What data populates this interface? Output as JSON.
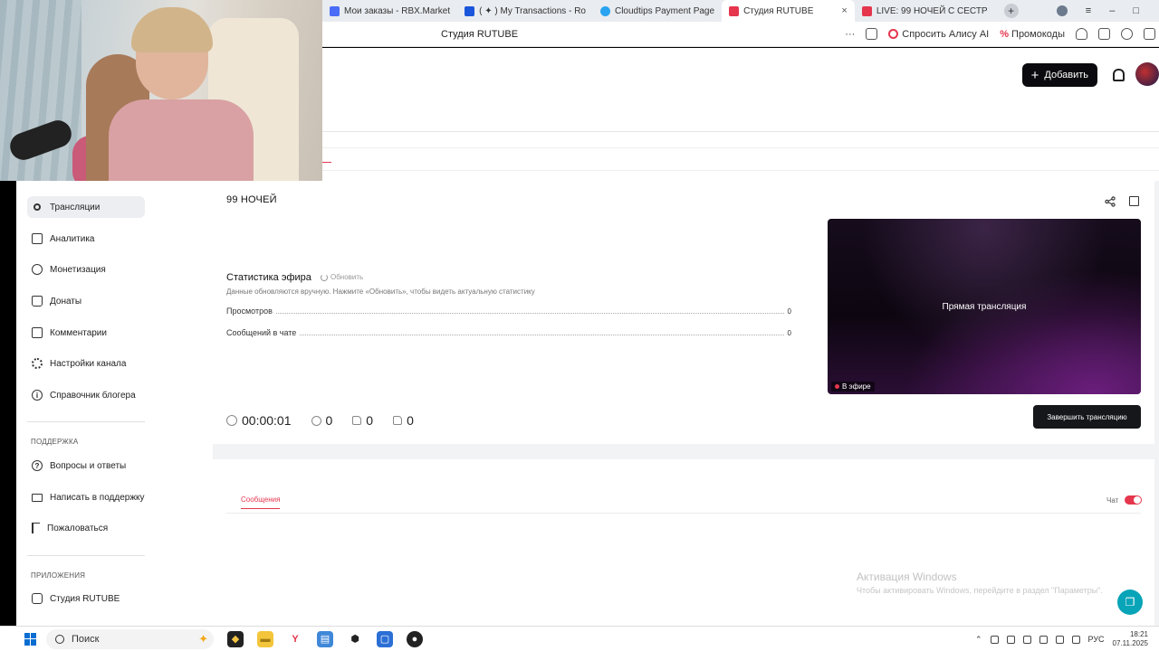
{
  "browser": {
    "tabs": [
      {
        "label": "Мои заказы - RBX.Market",
        "icon_color": "#4a6cf7",
        "active": false
      },
      {
        "label": "( ✦ ) My Transactions - Ro",
        "icon_color": "#1a56db",
        "active": false
      },
      {
        "label": "Cloudtips Payment Page",
        "icon_color": "#2aa3f0",
        "active": false
      },
      {
        "label": "Студия RUTUBE",
        "icon_color": "#e5364e",
        "active": true
      },
      {
        "label": "LIVE: 99 НОЧЕЙ С СЕСТР",
        "icon_color": "#e5364e",
        "active": false
      }
    ],
    "close_glyph": "×",
    "new_tab_glyph": "+",
    "window_controls": {
      "menu": "≡",
      "minimize": "–",
      "maximize": "□",
      "close": "×"
    },
    "address": "Студия RUTUBE",
    "more": "···",
    "alice_label": "Спросить Алису AI",
    "promo_label": "Промокоды",
    "promo_icon": "%"
  },
  "header": {
    "add_label": "Добавить",
    "add_icon": "+"
  },
  "sidebar": {
    "items": [
      {
        "label": "Трансляции",
        "icon": "broadcast-icon"
      },
      {
        "label": "Аналитика",
        "icon": "chart-icon"
      },
      {
        "label": "Монетизация",
        "icon": "coin-icon"
      },
      {
        "label": "Донаты",
        "icon": "bag-icon"
      },
      {
        "label": "Комментарии",
        "icon": "comment-icon"
      },
      {
        "label": "Настройки канала",
        "icon": "gear-icon"
      },
      {
        "label": "Справочник блогера",
        "icon": "info-icon"
      }
    ],
    "support_title": "ПОДДЕРЖКА",
    "support": [
      {
        "label": "Вопросы и ответы",
        "icon": "question-icon"
      },
      {
        "label": "Написать в поддержку",
        "icon": "mail-icon"
      },
      {
        "label": "Пожаловаться",
        "icon": "flag-icon"
      }
    ],
    "apps_title": "ПРИЛОЖЕНИЯ",
    "apps": [
      {
        "label": "Студия RUTUBE",
        "icon": "studio-icon"
      }
    ]
  },
  "broadcast": {
    "title": "99 НОЧЕЙ",
    "stats_title": "Статистика эфира",
    "refresh_label": "Обновить",
    "stats_note": "Данные обновляются вручную. Нажмите «Обновить», чтобы видеть актуальную статистику",
    "stats": [
      {
        "label": "Просмотров",
        "value": "0"
      },
      {
        "label": "Сообщений в чате",
        "value": "0"
      }
    ],
    "preview_label": "Прямая трансляция",
    "live_badge": "В эфире",
    "duration": "00:00:01",
    "viewers": "0",
    "likes": "0",
    "dislikes": "0",
    "end_label": "Завершить трансляцию"
  },
  "chat": {
    "tab_label": "Сообщения",
    "toggle_label": "Чат",
    "toggle_on": true
  },
  "windows_watermark": {
    "title": "Активация Windows",
    "subtitle": "Чтобы активировать Windows, перейдите в раздел \"Параметры\"."
  },
  "taskbar": {
    "search_placeholder": "Поиск",
    "language": "РУС",
    "time": "18:21",
    "date": "07.11.2025"
  }
}
